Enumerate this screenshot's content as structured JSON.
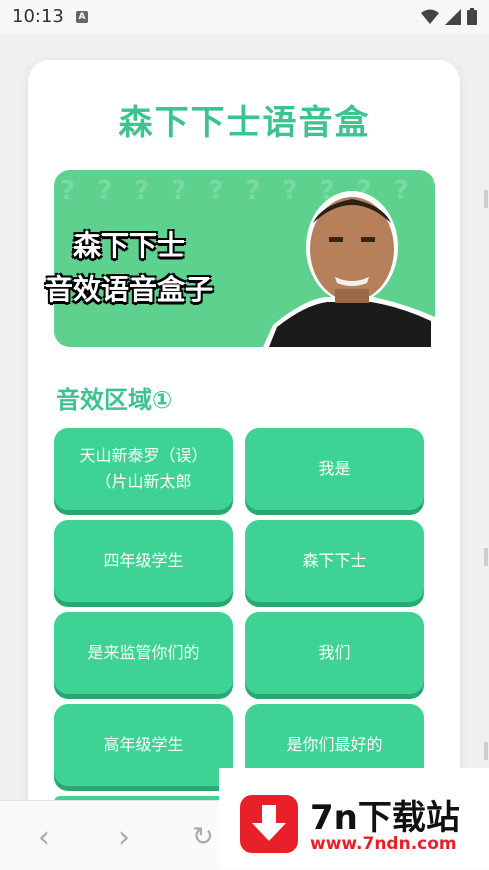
{
  "status": {
    "time": "10:13",
    "notif_glyph": "A"
  },
  "app": {
    "title": "森下下士语音盒"
  },
  "banner": {
    "line1": "森下下士",
    "line2": "音效语音盒子",
    "pattern": "??????????????????????????????????????????????????"
  },
  "section": {
    "title": "音效区域①"
  },
  "buttons": [
    {
      "label": "天山新泰罗（误）\n（片山新太郎"
    },
    {
      "label": "我是"
    },
    {
      "label": "四年级学生"
    },
    {
      "label": "森下下士"
    },
    {
      "label": "是来监管你们的"
    },
    {
      "label": "我们"
    },
    {
      "label": "高年级学生"
    },
    {
      "label": "是你们最好的"
    }
  ],
  "browser": {
    "back": "‹",
    "forward": "›",
    "reload": "↻"
  },
  "watermark": {
    "name": "7n下载站",
    "url": "www.7ndn.com"
  },
  "colors": {
    "accent": "#3cc48e",
    "button": "#3ed394",
    "watermark_red": "#e8202a"
  }
}
